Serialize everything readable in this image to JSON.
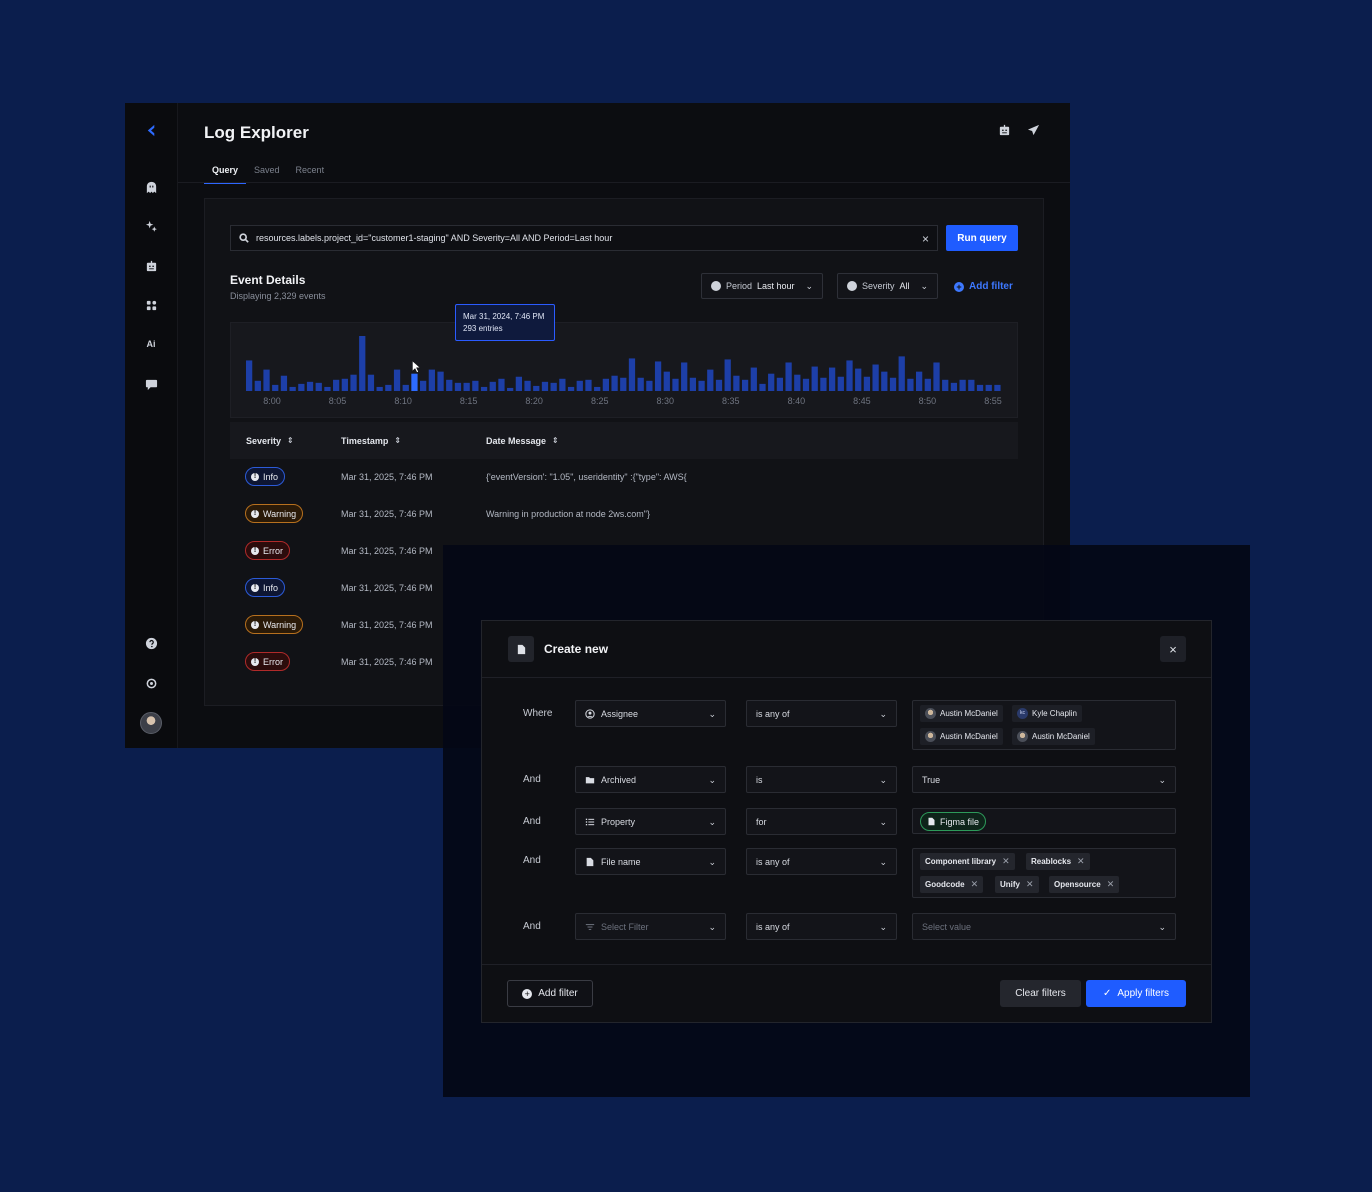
{
  "app": {
    "title": "Log Explorer",
    "tabs": [
      {
        "label": "Query",
        "active": true
      },
      {
        "label": "Saved",
        "active": false
      },
      {
        "label": "Recent",
        "active": false
      }
    ],
    "rail_icons": [
      "logo-icon",
      "ghost-icon",
      "sparkles-icon",
      "robot-icon",
      "apps-icon",
      "ai-icon",
      "chat-icon",
      "help-icon",
      "settings-icon"
    ],
    "top_icons": [
      "robot-icon",
      "send-icon"
    ]
  },
  "query": {
    "text": "resources.labels.project_id=\"customer1-staging\" AND Severity=All AND Period=Last hour",
    "clear": "×",
    "run_label": "Run query"
  },
  "events": {
    "title": "Event Details",
    "subtitle": "Displaying 2,329 events",
    "period_label": "Period",
    "period_value": "Last hour",
    "severity_label": "Severity",
    "severity_value": "All",
    "add_filter": "Add filter"
  },
  "tooltip": {
    "date": "Mar 31, 2024, 7:46 PM",
    "entries": "293 entries"
  },
  "chart_data": {
    "type": "bar",
    "x_tick_labels": [
      "8:00",
      "8:05",
      "8:10",
      "8:15",
      "8:20",
      "8:25",
      "8:30",
      "8:35",
      "8:40",
      "8:45",
      "8:50",
      "8:55"
    ],
    "values": [
      300,
      100,
      210,
      60,
      150,
      40,
      70,
      90,
      80,
      40,
      110,
      120,
      160,
      540,
      160,
      40,
      60,
      210,
      60,
      170,
      100,
      210,
      190,
      110,
      80,
      80,
      100,
      40,
      90,
      120,
      30,
      140,
      100,
      50,
      90,
      80,
      120,
      40,
      100,
      110,
      40,
      120,
      150,
      130,
      320,
      130,
      100,
      290,
      190,
      120,
      280,
      130,
      100,
      210,
      110,
      310,
      150,
      110,
      230,
      70,
      170,
      130,
      280,
      160,
      120,
      240,
      130,
      230,
      140,
      300,
      220,
      140,
      260,
      190,
      130,
      340,
      120,
      190,
      120,
      280,
      110,
      80,
      110,
      110,
      60,
      60,
      60
    ],
    "highlighted_index": 19,
    "colors": {
      "bar": "#1d3fa8",
      "highlight": "#2d6bff"
    }
  },
  "table": {
    "headers": [
      "Severity",
      "Timestamp",
      "Date Message"
    ],
    "rows": [
      {
        "severity": "Info",
        "kind": "info",
        "timestamp": "Mar 31, 2025, 7:46 PM",
        "message": "{'eventVersion': \"1.05\", useridentity\" :{\"type\": AWS{"
      },
      {
        "severity": "Warning",
        "kind": "warn",
        "timestamp": "Mar 31, 2025, 7:46 PM",
        "message": "Warning in production at node 2ws.com\"}"
      },
      {
        "severity": "Error",
        "kind": "err",
        "timestamp": "Mar 31, 2025, 7:46 PM",
        "message": ""
      },
      {
        "severity": "Info",
        "kind": "info",
        "timestamp": "Mar 31, 2025, 7:46 PM",
        "message": ""
      },
      {
        "severity": "Warning",
        "kind": "warn",
        "timestamp": "Mar 31, 2025, 7:46 PM",
        "message": ""
      },
      {
        "severity": "Error",
        "kind": "err",
        "timestamp": "Mar 31, 2025, 7:46 PM",
        "message": ""
      }
    ]
  },
  "dialog": {
    "title": "Create new",
    "close": "×",
    "rows": [
      {
        "conj": "Where",
        "field": "Assignee",
        "op": "is any of"
      },
      {
        "conj": "And",
        "field": "Archived",
        "op": "is",
        "value": "True"
      },
      {
        "conj": "And",
        "field": "Property",
        "op": "for",
        "value": "Figma file"
      },
      {
        "conj": "And",
        "field": "File name",
        "op": "is any of"
      },
      {
        "conj": "And",
        "field": "Select Filter",
        "op": "is any of",
        "value": "Select value"
      }
    ],
    "assignees": [
      {
        "name": "Austin McDaniel",
        "avatar": "photo"
      },
      {
        "name": "Kyle Chaplin",
        "avatar": "KC"
      },
      {
        "name": "Austin McDaniel",
        "avatar": "photo"
      },
      {
        "name": "Austin McDaniel",
        "avatar": "photo"
      }
    ],
    "avatar_initials": "kc",
    "file_tags": [
      "Component library",
      "Reablocks",
      "Goodcode",
      "Unify",
      "Opensource"
    ],
    "add_filter": "Add filter",
    "clear_filters": "Clear filters",
    "apply_filters": "Apply filters"
  }
}
